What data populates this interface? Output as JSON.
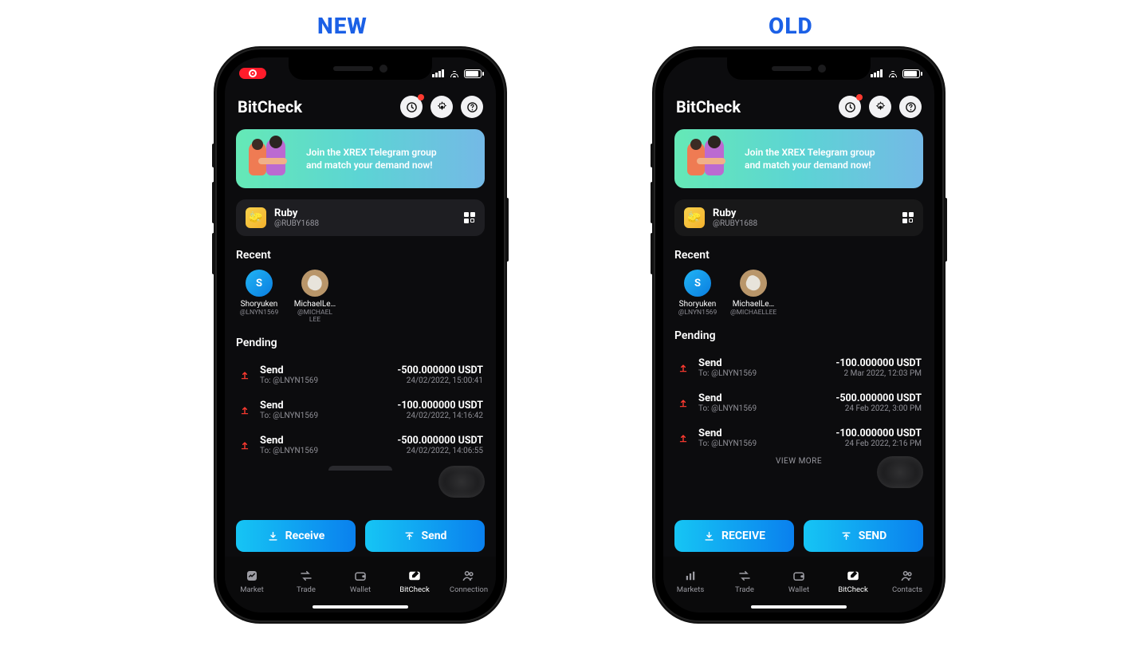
{
  "labels": {
    "new": "NEW",
    "old": "OLD"
  },
  "common": {
    "app_title": "BitCheck",
    "promo_line1": "Join the XREX Telegram group",
    "promo_line2": "and match your demand now!",
    "user_name": "Ruby",
    "user_handle": "@RUBY1688",
    "section_recent": "Recent",
    "section_pending": "Pending",
    "recent": [
      {
        "initial": "S",
        "name": "Shoryuken",
        "handle_new": "@LNYN1569",
        "handle_old": "@LNYN1569",
        "style": "blue"
      },
      {
        "initial": "",
        "name": "MichaelLe…",
        "handle_new": "@MICHAEL LEE",
        "handle_old": "@MICHAELLEE",
        "style": "tan"
      }
    ]
  },
  "new": {
    "pending": [
      {
        "title": "Send",
        "to": "To: @LNYN1569",
        "amount": "-500.000000 USDT",
        "date": "24/02/2022, 15:00:41"
      },
      {
        "title": "Send",
        "to": "To: @LNYN1569",
        "amount": "-100.000000 USDT",
        "date": "24/02/2022, 14:16:42"
      },
      {
        "title": "Send",
        "to": "To: @LNYN1569",
        "amount": "-500.000000 USDT",
        "date": "24/02/2022, 14:06:55"
      }
    ],
    "actions": {
      "receive": "Receive",
      "send": "Send"
    },
    "tabs": [
      "Market",
      "Trade",
      "Wallet",
      "BitCheck",
      "Connection"
    ],
    "active_tab": 3
  },
  "old": {
    "pending": [
      {
        "title": "Send",
        "to": "To: @LNYN1569",
        "amount": "-100.000000 USDT",
        "date": "2 Mar 2022, 12:03 PM"
      },
      {
        "title": "Send",
        "to": "To: @LNYN1569",
        "amount": "-500.000000 USDT",
        "date": "24 Feb 2022, 3:00 PM"
      },
      {
        "title": "Send",
        "to": "To: @LNYN1569",
        "amount": "-100.000000 USDT",
        "date": "24 Feb 2022, 2:16 PM"
      }
    ],
    "view_more": "VIEW MORE",
    "actions": {
      "receive": "RECEIVE",
      "send": "SEND"
    },
    "tabs": [
      "Markets",
      "Trade",
      "Wallet",
      "BitCheck",
      "Contacts"
    ],
    "active_tab": 3
  }
}
